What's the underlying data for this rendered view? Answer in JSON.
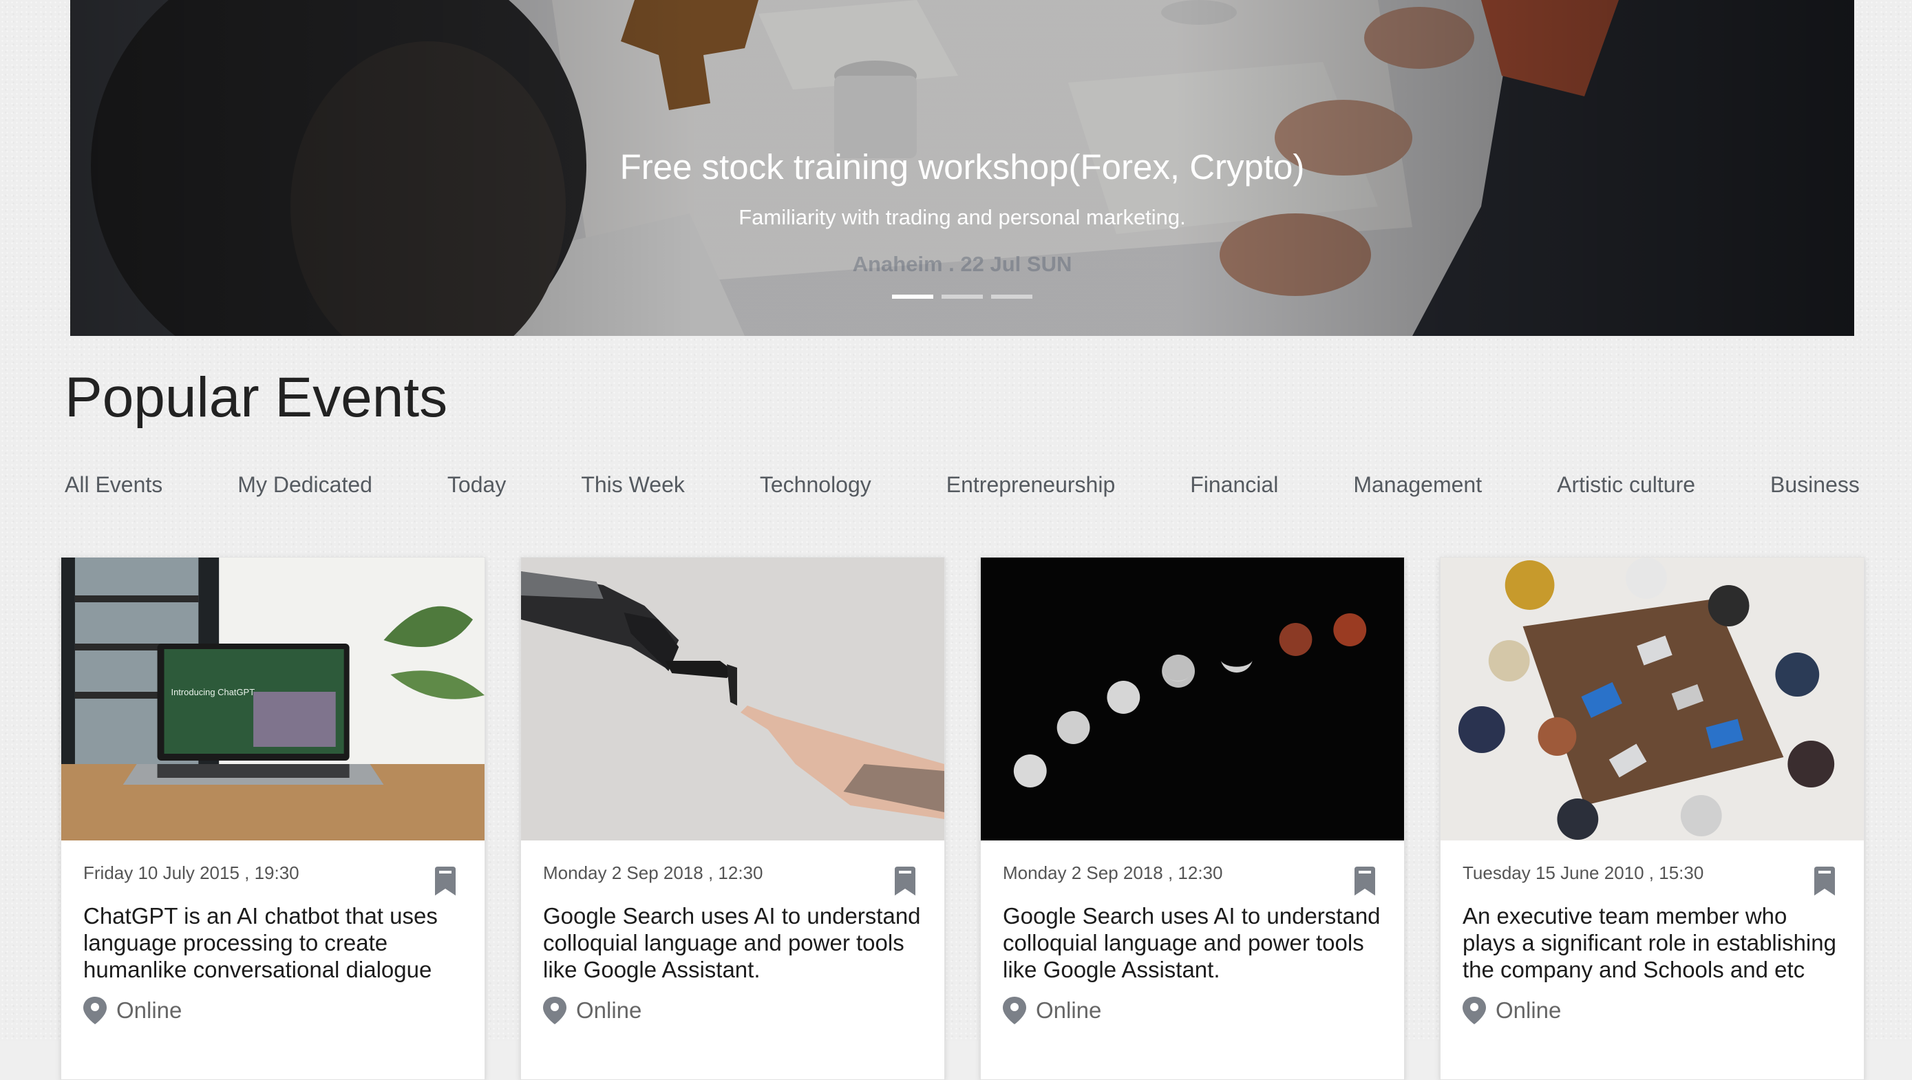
{
  "hero": {
    "title": "Free stock training workshop(Forex, Crypto)",
    "subtitle": "Familiarity with trading and personal marketing.",
    "meta": "Anaheim . 22 Jul SUN",
    "slides": 3,
    "active_slide": 1
  },
  "section": {
    "title": "Popular Events"
  },
  "filters": [
    {
      "label": "All Events"
    },
    {
      "label": "My Dedicated"
    },
    {
      "label": "Today"
    },
    {
      "label": "This Week"
    },
    {
      "label": "Technology"
    },
    {
      "label": "Entrepreneurship"
    },
    {
      "label": "Financial"
    },
    {
      "label": "Management"
    },
    {
      "label": "Artistic culture"
    },
    {
      "label": "Business"
    }
  ],
  "events": [
    {
      "date": "Friday 10 July 2015 , 19:30",
      "title": "ChatGPT is an AI chatbot that uses language processing to create humanlike conversational dialogue",
      "location": "Online",
      "image_text": "Introducing ChatGPT"
    },
    {
      "date": "Monday 2 Sep 2018 , 12:30",
      "title": "Google Search uses AI to understand colloquial language and power tools like Google Assistant.",
      "location": "Online"
    },
    {
      "date": "Monday 2 Sep 2018 , 12:30",
      "title": "Google Search uses AI to understand colloquial language and power tools like Google Assistant.",
      "location": "Online"
    },
    {
      "date": "Tuesday 15 June 2010 , 15:30",
      "title": "An executive team member who plays a significant role in establishing the company and Schools and etc",
      "location": "Online"
    }
  ],
  "icons": {
    "bookmark": "bookmark-icon",
    "location": "location-pin-icon"
  },
  "colors": {
    "icon_gray": "#7b8088",
    "filter_text": "#555a60"
  }
}
